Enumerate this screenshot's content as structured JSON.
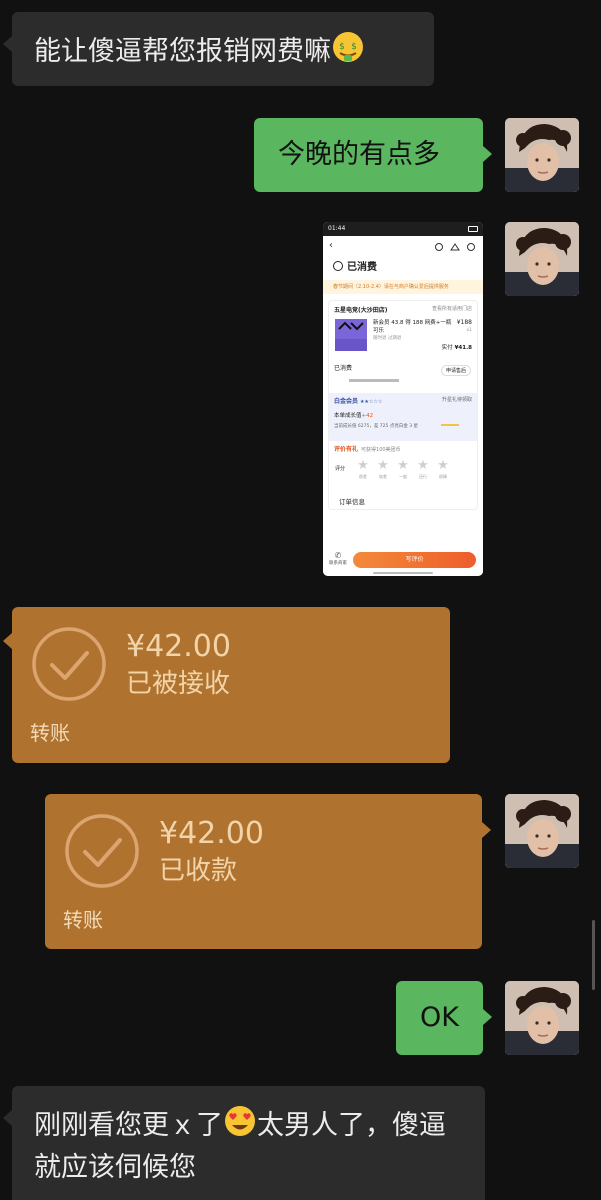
{
  "messages": {
    "m1": {
      "text": "能让傻逼帮您报销网费嘛",
      "emoji": "money-mouth-face"
    },
    "m2": {
      "text": "今晚的有点多"
    },
    "m3": {
      "screenshot": {
        "status_time": "01:44",
        "page_title": "已消费",
        "notice": "春节期间（2.10-2.4）请在与商户确认爱后提供服务",
        "store_name": "五星电竞(大沙田店)",
        "store_link": "查看所有适用门店",
        "product": "新会员 43.8 得 188 网费+一瓶可乐",
        "product_sub": "随时退 过期退",
        "price": "¥188",
        "qty": "x1",
        "paid_label": "实付",
        "paid": "¥41.8",
        "used_label": "已消费",
        "after_sale": "申请售后",
        "member_title": "白金会员",
        "member_right": "升星礼待领取",
        "growth_label": "本单成长值",
        "growth_value": "+42",
        "growth_detail": "当前成长值 6275，差 725 点亮白金 3 星",
        "review_title": "评价有礼",
        "review_sub": "可获得100美团币",
        "rating_label": "评分",
        "star_labels": [
          "很差",
          "较差",
          "一般",
          "还行",
          "很棒"
        ],
        "order_info": "订单信息",
        "contact": "联系商家",
        "write_review": "写评价"
      }
    },
    "t1": {
      "amount": "¥42.00",
      "status": "已被接收",
      "label": "转账"
    },
    "t2": {
      "amount": "¥42.00",
      "status": "已收款",
      "label": "转账"
    },
    "m4": {
      "text": "OK"
    },
    "m5": {
      "part1": "刚刚看您更ｘ了",
      "emoji": "smiling-face-with-heart-eyes",
      "part2": "太男人了，傻逼就应该伺候您"
    }
  },
  "colors": {
    "background": "#111111",
    "incoming_bubble": "#2c2c2c",
    "outgoing_bubble": "#5bb660",
    "transfer_bubble": "#b0732f"
  }
}
